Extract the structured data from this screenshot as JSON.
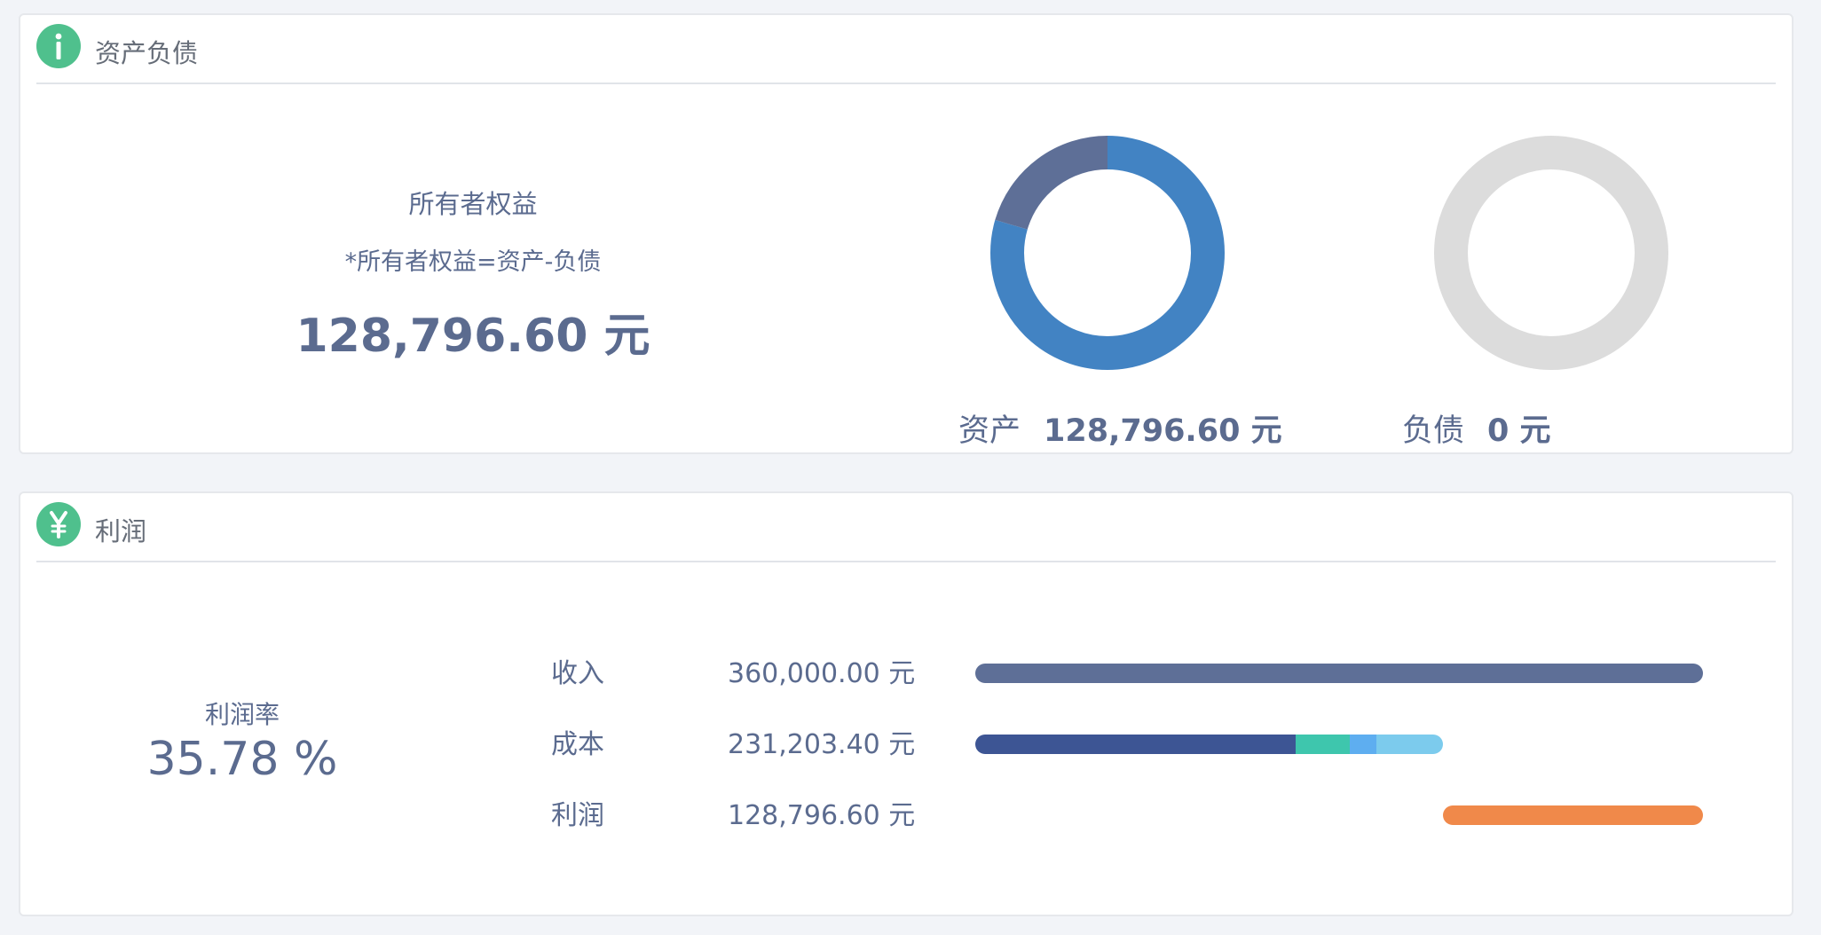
{
  "balance": {
    "title": "资产负债",
    "equity_label": "所有者权益",
    "equity_formula": "*所有者权益=资产-负债",
    "equity_value": "128,796.60 元",
    "assets_label": "资产",
    "assets_value": "128,796.60 元",
    "liabilities_label": "负债",
    "liabilities_value": "0 元",
    "assets_donut": {
      "segments": [
        {
          "fraction": 0.795,
          "color": "#4283c3"
        },
        {
          "fraction": 0.205,
          "color": "#5e6f97"
        }
      ]
    },
    "liabilities_donut": {
      "segments": [
        {
          "fraction": 1.0,
          "color": "#dcdcdc"
        }
      ]
    }
  },
  "profit": {
    "title": "利润",
    "rate_label": "利润率",
    "rate_value": "35.78 %",
    "rows": [
      {
        "label": "收入",
        "value": "360,000.00 元"
      },
      {
        "label": "成本",
        "value": "231,203.40 元"
      },
      {
        "label": "利润",
        "value": "128,796.60 元"
      }
    ],
    "bars": {
      "income": {
        "amount": 360000.0,
        "color": "#5e6f97"
      },
      "cost_segments": [
        {
          "amount": 158400,
          "color": "#3d5594"
        },
        {
          "amount": 26800,
          "color": "#3ec6ad"
        },
        {
          "amount": 13100,
          "color": "#5eaef0"
        },
        {
          "amount": 32903.4,
          "color": "#7ccbed"
        }
      ],
      "profit": {
        "amount": 128796.6,
        "color": "#f0894a"
      }
    }
  }
}
